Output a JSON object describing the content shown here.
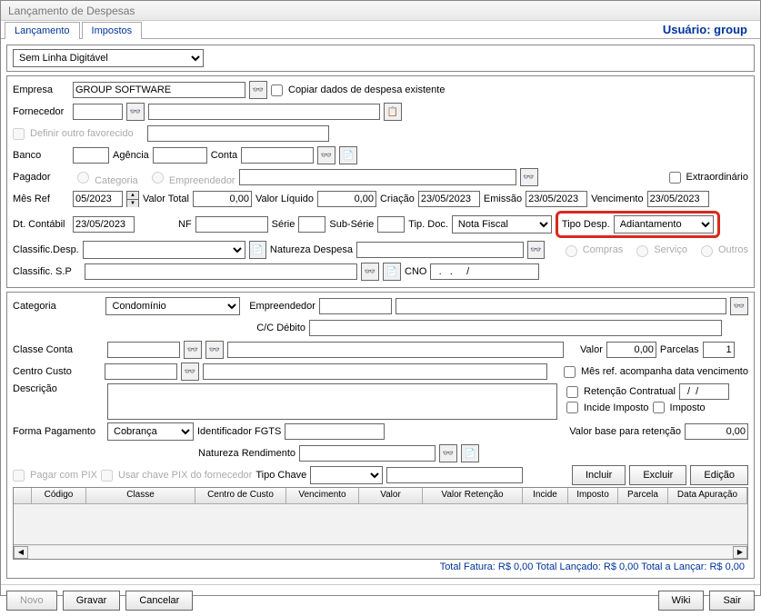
{
  "window_title": "Lançamento de Despesas",
  "tabs": {
    "lancamento": "Lançamento",
    "impostos": "Impostos"
  },
  "user_label": "Usuário: group",
  "linha_digitavel": "Sem Linha Digitável",
  "empresa": {
    "label": "Empresa",
    "value": "GROUP SOFTWARE"
  },
  "copiar_chk": "Copiar dados de despesa existente",
  "fornecedor_label": "Fornecedor",
  "definir_favorecido": "Definir outro favorecido",
  "banco_label": "Banco",
  "agencia_label": "Agência",
  "conta_label": "Conta",
  "pagador_label": "Pagador",
  "pagador_opts": {
    "categoria": "Categoria",
    "empreendedor": "Empreendedor"
  },
  "extraordinario": "Extraordinário",
  "mesref": {
    "label": "Mês Ref",
    "value": "05/2023"
  },
  "valor_total": {
    "label": "Valor Total",
    "value": "0,00"
  },
  "valor_liquido": {
    "label": "Valor Líquido",
    "value": "0,00"
  },
  "criacao": {
    "label": "Criação",
    "value": "23/05/2023"
  },
  "emissao": {
    "label": "Emissão",
    "value": "23/05/2023"
  },
  "vencimento": {
    "label": "Vencimento",
    "value": "23/05/2023"
  },
  "dt_contabil": {
    "label": "Dt. Contábil",
    "value": "23/05/2023"
  },
  "nf_label": "NF",
  "serie_label": "Série",
  "subserie_label": "Sub-Série",
  "tipdoc": {
    "label": "Tip. Doc.",
    "value": "Nota Fiscal"
  },
  "tipodesp": {
    "label": "Tipo Desp.",
    "value": "Adiantamento"
  },
  "classific_desp": "Classific.Desp.",
  "natureza_despesa": "Natureza Despesa",
  "classific_sp": "Classific. S.P",
  "cno": {
    "label": "CNO",
    "value": "  .   .     /"
  },
  "opc_compras": "Compras",
  "opc_servico": "Serviço",
  "opc_outros": "Outros",
  "categoria": {
    "label": "Categoria",
    "value": "Condomínio"
  },
  "empreendedor_label": "Empreendedor",
  "cc_debito": "C/C Débito",
  "classe_conta": "Classe Conta",
  "centro_custo": "Centro Custo",
  "descricao": "Descrição",
  "valor": {
    "label": "Valor",
    "value": "0,00"
  },
  "parcelas": {
    "label": "Parcelas",
    "value": "1"
  },
  "mesref_venc": "Mês ref. acompanha data vencimento",
  "retencao": {
    "label": "Retenção Contratual",
    "value": "  /  /"
  },
  "incide_imposto": "Incide Imposto",
  "imposto_chk": "Imposto",
  "forma_pagto": {
    "label": "Forma Pagamento",
    "value": "Cobrança"
  },
  "ident_fgts": "Identificador FGTS",
  "valor_base_ret": {
    "label": "Valor base para retenção",
    "value": "0,00"
  },
  "natureza_rend": "Natureza Rendimento",
  "pagar_pix": "Pagar com PIX",
  "usar_chave_pix": "Usar chave PIX do fornecedor",
  "tipo_chave": "Tipo Chave",
  "btn_incluir": "Incluir",
  "btn_excluir": "Excluir",
  "btn_edicao": "Edição",
  "table_headers": [
    "Código",
    "Classe",
    "Centro de Custo",
    "Vencimento",
    "Valor",
    "Valor Retenção",
    "Incide",
    "Imposto",
    "Parcela",
    "Data Apuração"
  ],
  "totals": "Total Fatura: R$ 0,00  Total Lançado: R$ 0,00  Total a Lançar: R$ 0,00",
  "footer": {
    "novo": "Novo",
    "gravar": "Gravar",
    "cancelar": "Cancelar",
    "wiki": "Wiki",
    "sair": "Sair"
  }
}
